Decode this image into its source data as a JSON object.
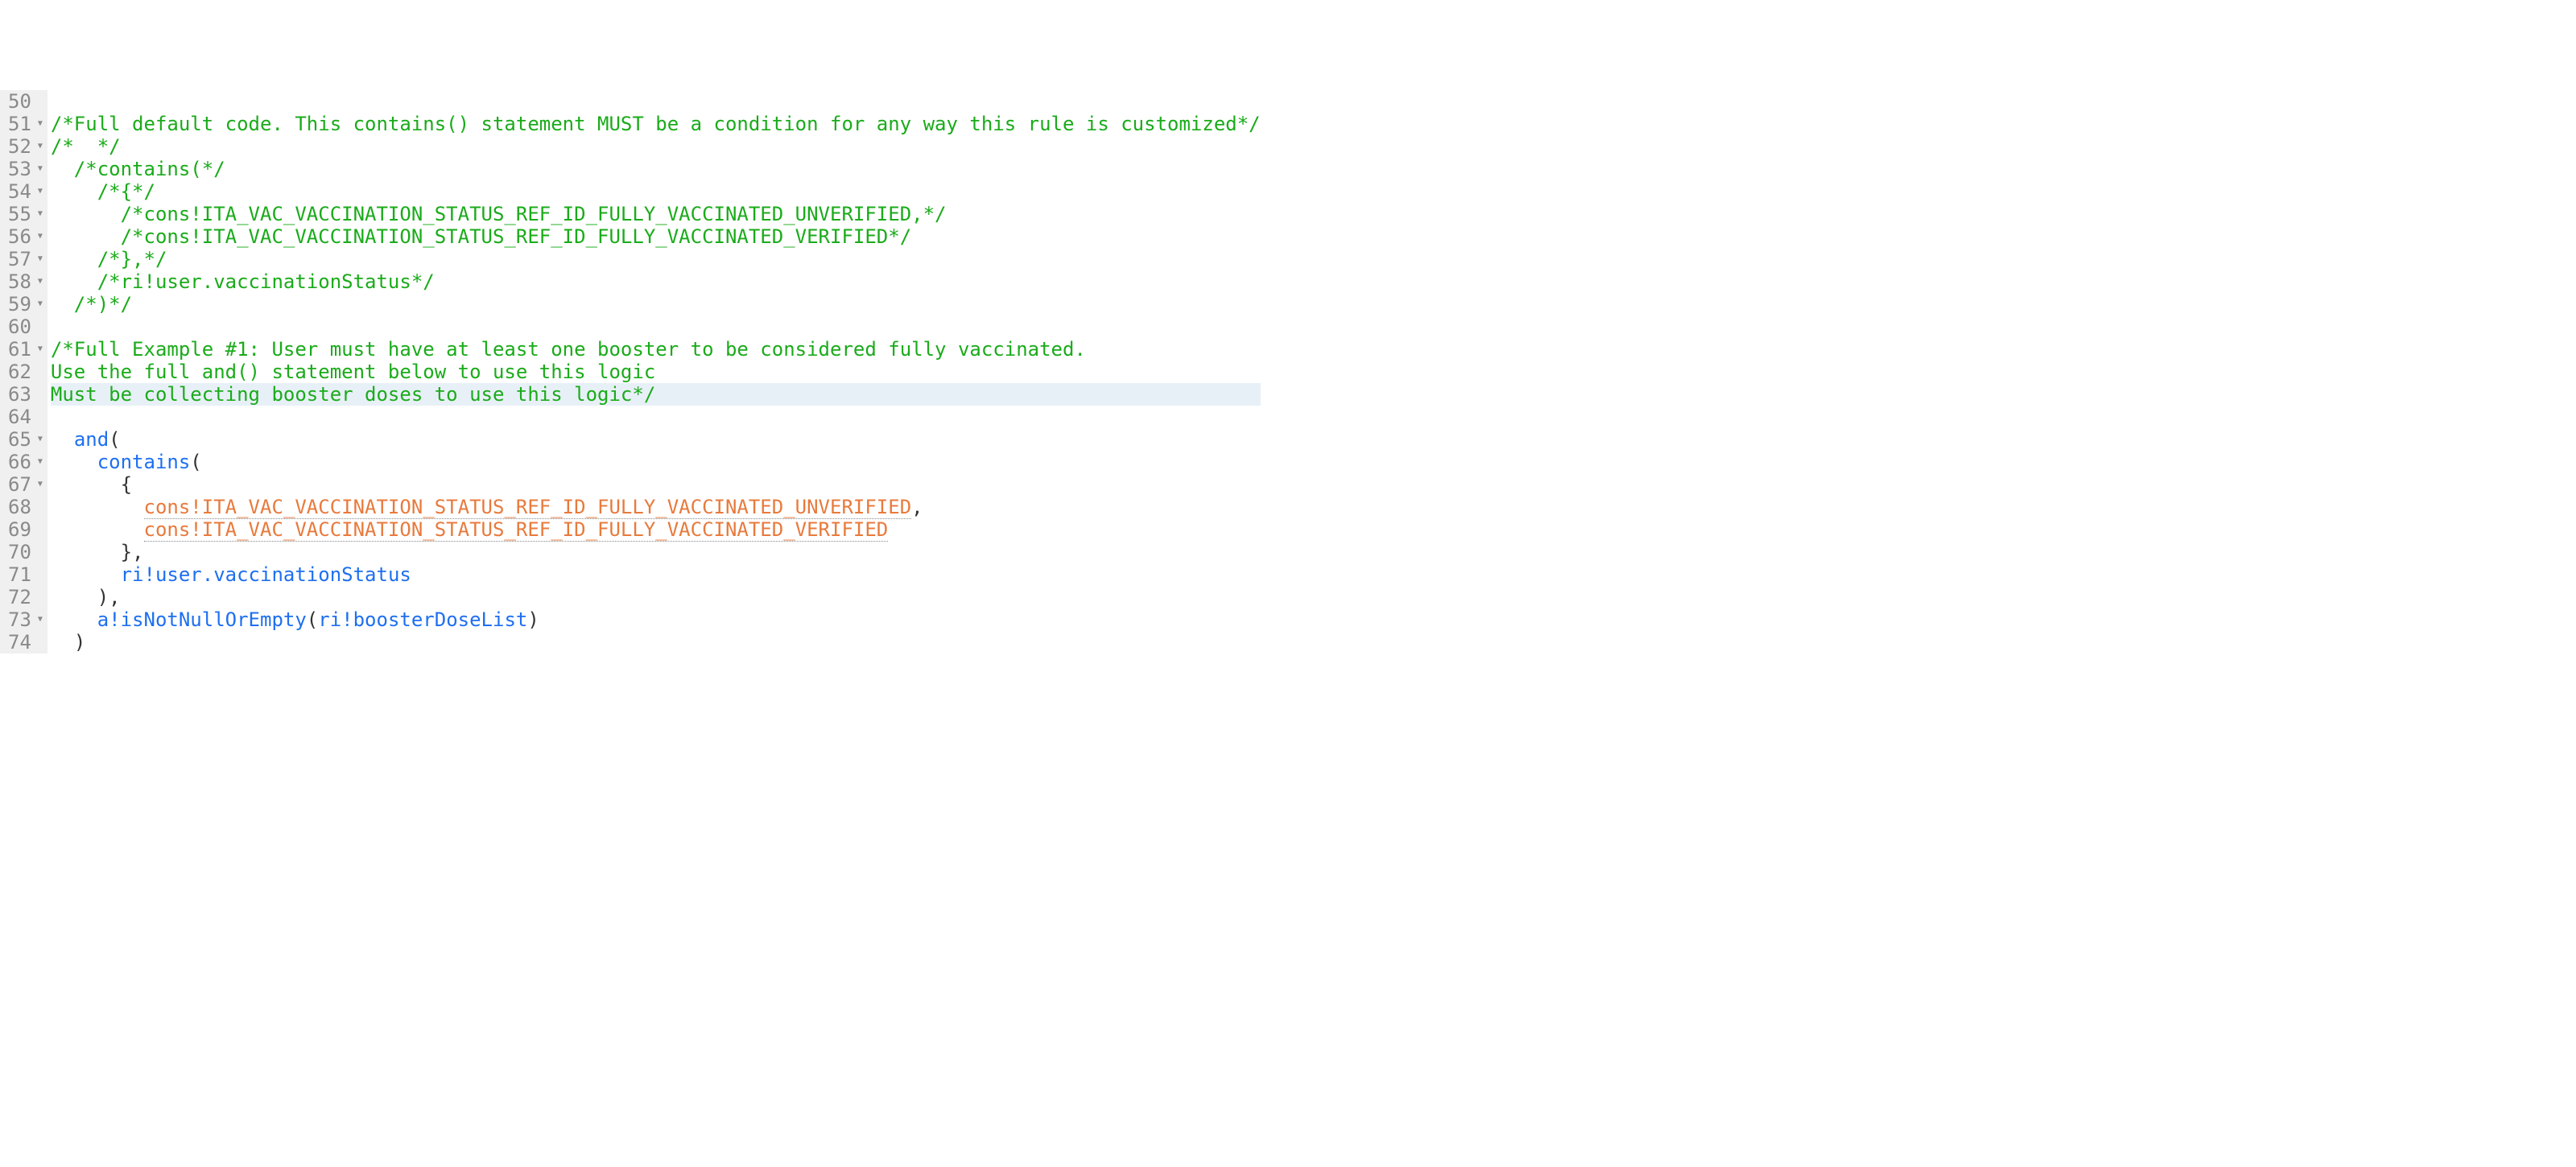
{
  "lines": [
    {
      "num": "50",
      "fold": false,
      "hl": false,
      "segs": []
    },
    {
      "num": "51",
      "fold": true,
      "hl": false,
      "segs": [
        {
          "cls": "c",
          "t": "/*Full default code. This contains() statement MUST be a condition for any way this rule is customized*/"
        }
      ]
    },
    {
      "num": "52",
      "fold": true,
      "hl": false,
      "segs": [
        {
          "cls": "c",
          "t": "/*  */"
        }
      ]
    },
    {
      "num": "53",
      "fold": true,
      "hl": false,
      "segs": [
        {
          "cls": "c",
          "t": "  /*contains(*/"
        }
      ]
    },
    {
      "num": "54",
      "fold": true,
      "hl": false,
      "segs": [
        {
          "cls": "c",
          "t": "    /*{*/"
        }
      ]
    },
    {
      "num": "55",
      "fold": true,
      "hl": false,
      "segs": [
        {
          "cls": "c",
          "t": "      /*cons!ITA_VAC_VACCINATION_STATUS_REF_ID_FULLY_VACCINATED_UNVERIFIED,*/"
        }
      ]
    },
    {
      "num": "56",
      "fold": true,
      "hl": false,
      "segs": [
        {
          "cls": "c",
          "t": "      /*cons!ITA_VAC_VACCINATION_STATUS_REF_ID_FULLY_VACCINATED_VERIFIED*/"
        }
      ]
    },
    {
      "num": "57",
      "fold": true,
      "hl": false,
      "segs": [
        {
          "cls": "c",
          "t": "    /*},*/"
        }
      ]
    },
    {
      "num": "58",
      "fold": true,
      "hl": false,
      "segs": [
        {
          "cls": "c",
          "t": "    /*ri!user.vaccinationStatus*/"
        }
      ]
    },
    {
      "num": "59",
      "fold": true,
      "hl": false,
      "segs": [
        {
          "cls": "c",
          "t": "  /*)*/"
        }
      ]
    },
    {
      "num": "60",
      "fold": false,
      "hl": false,
      "segs": []
    },
    {
      "num": "61",
      "fold": true,
      "hl": false,
      "segs": [
        {
          "cls": "c",
          "t": "/*Full Example #1: User must have at least one booster to be considered fully vaccinated."
        }
      ]
    },
    {
      "num": "62",
      "fold": false,
      "hl": false,
      "segs": [
        {
          "cls": "c",
          "t": "Use the full and() statement below to use this logic"
        }
      ]
    },
    {
      "num": "63",
      "fold": false,
      "hl": true,
      "segs": [
        {
          "cls": "c",
          "t": "Must be collecting booster doses to use this logic*/"
        }
      ]
    },
    {
      "num": "64",
      "fold": false,
      "hl": false,
      "segs": []
    },
    {
      "num": "65",
      "fold": true,
      "hl": false,
      "segs": [
        {
          "cls": "txt",
          "t": "  "
        },
        {
          "cls": "k",
          "t": "and"
        },
        {
          "cls": "p",
          "t": "("
        }
      ]
    },
    {
      "num": "66",
      "fold": true,
      "hl": false,
      "segs": [
        {
          "cls": "txt",
          "t": "    "
        },
        {
          "cls": "k",
          "t": "contains"
        },
        {
          "cls": "p",
          "t": "("
        }
      ]
    },
    {
      "num": "67",
      "fold": true,
      "hl": false,
      "segs": [
        {
          "cls": "txt",
          "t": "      "
        },
        {
          "cls": "p",
          "t": "{"
        }
      ]
    },
    {
      "num": "68",
      "fold": false,
      "hl": false,
      "segs": [
        {
          "cls": "txt",
          "t": "        "
        },
        {
          "cls": "con",
          "t": "cons!ITA_VAC_VACCINATION_STATUS_REF_ID_FULLY_VACCINATED_UNVERIFIED"
        },
        {
          "cls": "p",
          "t": ","
        }
      ]
    },
    {
      "num": "69",
      "fold": false,
      "hl": false,
      "segs": [
        {
          "cls": "txt",
          "t": "        "
        },
        {
          "cls": "con",
          "t": "cons!ITA_VAC_VACCINATION_STATUS_REF_ID_FULLY_VACCINATED_VERIFIED"
        }
      ]
    },
    {
      "num": "70",
      "fold": false,
      "hl": false,
      "segs": [
        {
          "cls": "txt",
          "t": "      "
        },
        {
          "cls": "p",
          "t": "},"
        }
      ]
    },
    {
      "num": "71",
      "fold": false,
      "hl": false,
      "segs": [
        {
          "cls": "txt",
          "t": "      "
        },
        {
          "cls": "id",
          "t": "ri!user.vaccinationStatus"
        }
      ]
    },
    {
      "num": "72",
      "fold": false,
      "hl": false,
      "segs": [
        {
          "cls": "txt",
          "t": "    "
        },
        {
          "cls": "p",
          "t": "),"
        }
      ]
    },
    {
      "num": "73",
      "fold": true,
      "hl": false,
      "segs": [
        {
          "cls": "txt",
          "t": "    "
        },
        {
          "cls": "k",
          "t": "a!isNotNullOrEmpty"
        },
        {
          "cls": "p",
          "t": "("
        },
        {
          "cls": "id",
          "t": "ri!boosterDoseList"
        },
        {
          "cls": "p",
          "t": ")"
        }
      ]
    },
    {
      "num": "74",
      "fold": false,
      "hl": false,
      "segs": [
        {
          "cls": "txt",
          "t": "  "
        },
        {
          "cls": "p",
          "t": ")"
        }
      ]
    }
  ]
}
